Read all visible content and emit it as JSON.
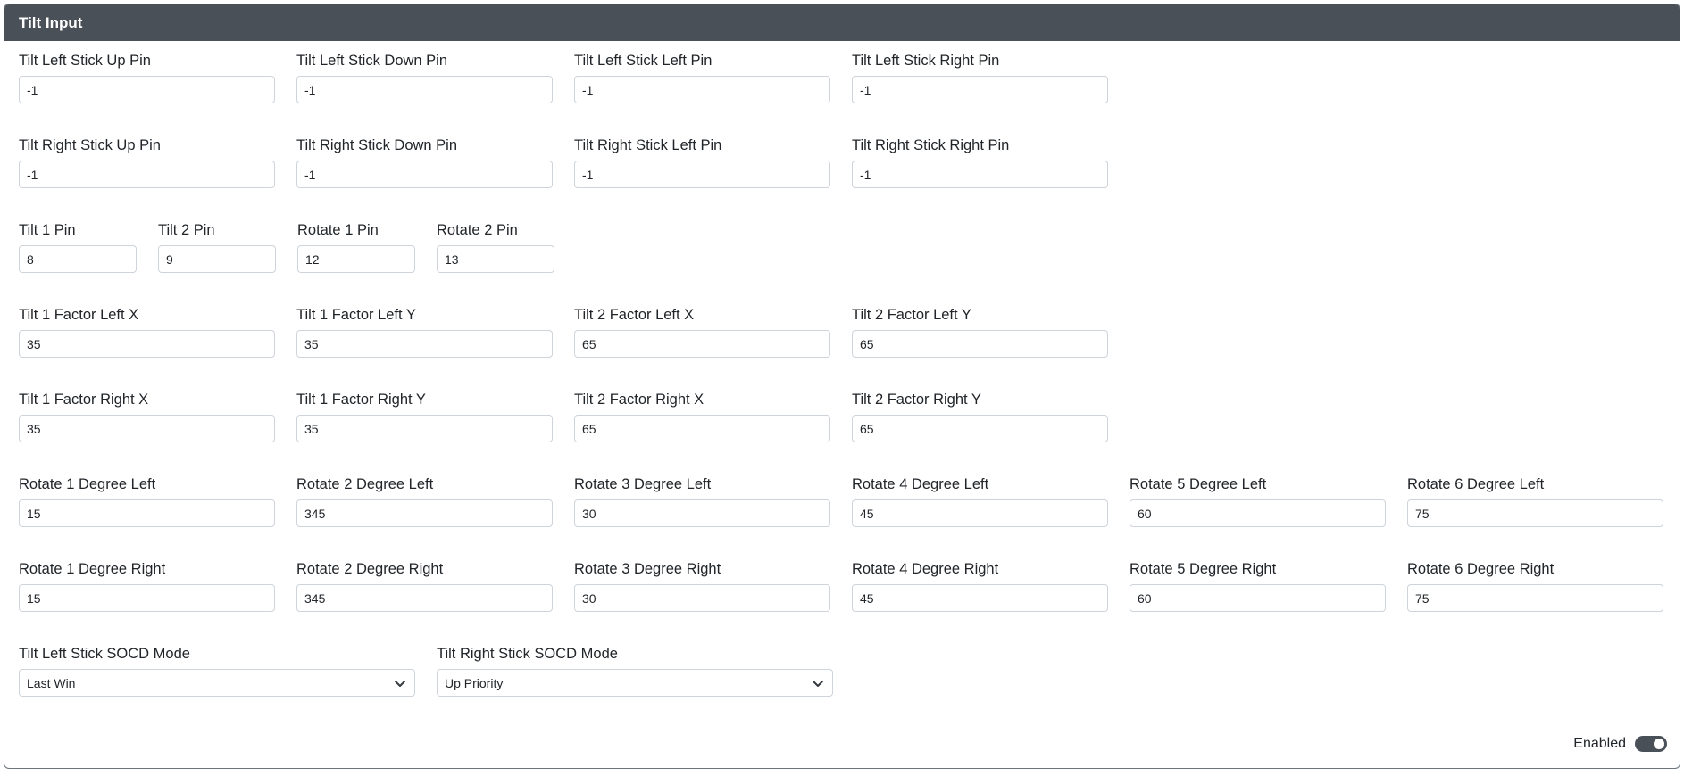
{
  "panel": {
    "title": "Tilt Input"
  },
  "rows": {
    "r1": [
      {
        "label": "Tilt Left Stick Up Pin",
        "value": "-1"
      },
      {
        "label": "Tilt Left Stick Down Pin",
        "value": "-1"
      },
      {
        "label": "Tilt Left Stick Left Pin",
        "value": "-1"
      },
      {
        "label": "Tilt Left Stick Right Pin",
        "value": "-1"
      }
    ],
    "r2": [
      {
        "label": "Tilt Right Stick Up Pin",
        "value": "-1"
      },
      {
        "label": "Tilt Right Stick Down Pin",
        "value": "-1"
      },
      {
        "label": "Tilt Right Stick Left Pin",
        "value": "-1"
      },
      {
        "label": "Tilt Right Stick Right Pin",
        "value": "-1"
      }
    ],
    "r3": [
      {
        "label": "Tilt 1 Pin",
        "value": "8"
      },
      {
        "label": "Tilt 2 Pin",
        "value": "9"
      },
      {
        "label": "Rotate 1 Pin",
        "value": "12"
      },
      {
        "label": "Rotate 2 Pin",
        "value": "13"
      }
    ],
    "r4": [
      {
        "label": "Tilt 1 Factor Left X",
        "value": "35"
      },
      {
        "label": "Tilt 1 Factor Left Y",
        "value": "35"
      },
      {
        "label": "Tilt 2 Factor Left X",
        "value": "65"
      },
      {
        "label": "Tilt 2 Factor Left Y",
        "value": "65"
      }
    ],
    "r5": [
      {
        "label": "Tilt 1 Factor Right X",
        "value": "35"
      },
      {
        "label": "Tilt 1 Factor Right Y",
        "value": "35"
      },
      {
        "label": "Tilt 2 Factor Right X",
        "value": "65"
      },
      {
        "label": "Tilt 2 Factor Right Y",
        "value": "65"
      }
    ],
    "r6": [
      {
        "label": "Rotate 1 Degree Left",
        "value": "15"
      },
      {
        "label": "Rotate 2 Degree Left",
        "value": "345"
      },
      {
        "label": "Rotate 3 Degree Left",
        "value": "30"
      },
      {
        "label": "Rotate 4 Degree Left",
        "value": "45"
      },
      {
        "label": "Rotate 5 Degree Left",
        "value": "60"
      },
      {
        "label": "Rotate 6 Degree Left",
        "value": "75"
      }
    ],
    "r7": [
      {
        "label": "Rotate 1 Degree Right",
        "value": "15"
      },
      {
        "label": "Rotate 2 Degree Right",
        "value": "345"
      },
      {
        "label": "Rotate 3 Degree Right",
        "value": "30"
      },
      {
        "label": "Rotate 4 Degree Right",
        "value": "45"
      },
      {
        "label": "Rotate 5 Degree Right",
        "value": "60"
      },
      {
        "label": "Rotate 6 Degree Right",
        "value": "75"
      }
    ]
  },
  "socd": [
    {
      "label": "Tilt Left Stick SOCD Mode",
      "value": "Last Win"
    },
    {
      "label": "Tilt Right Stick SOCD Mode",
      "value": "Up Priority"
    }
  ],
  "toggle": {
    "label": "Enabled",
    "state": "on",
    "color": "#495057"
  },
  "icons": {
    "select_arrow": "chevron-down-icon"
  }
}
